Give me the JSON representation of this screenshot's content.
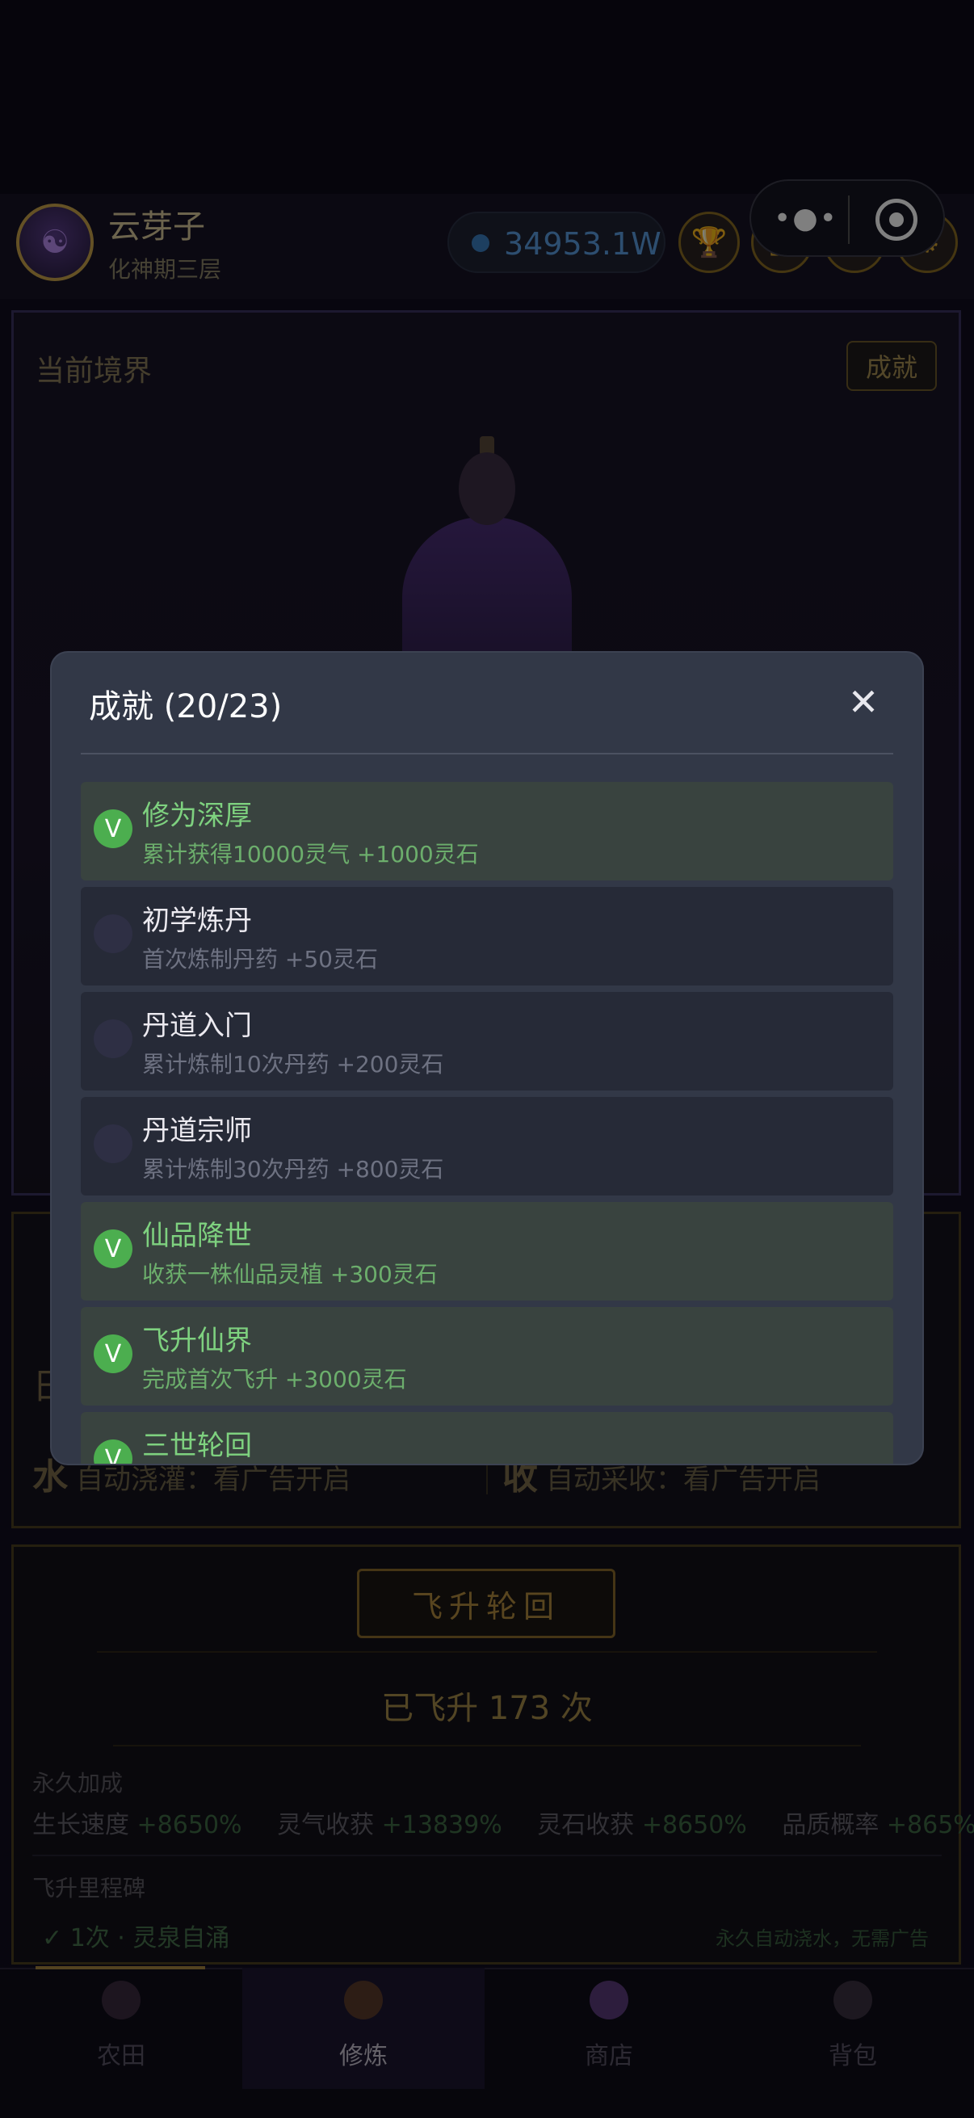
{
  "header": {
    "user_name": "云芽子",
    "user_realm": "化神期三层",
    "spirit_stones": "34953.1W",
    "avatar_glyph": "☯",
    "icons": [
      "trophy-icon",
      "book-icon",
      "help-icon",
      "settings-icon"
    ],
    "icon_glyphs": [
      "🏆",
      "▣",
      "?",
      "⚙"
    ]
  },
  "capsule": {
    "more_glyph": "•●•"
  },
  "realm": {
    "title": "当前境界",
    "achievement_button": "成就"
  },
  "farm": {
    "day_glyph": "日",
    "water_glyph": "水",
    "water_text": "自动浇灌：看广告开启",
    "harvest_glyph": "收",
    "harvest_text": "自动采收：看广告开启"
  },
  "ascension": {
    "button": "飞升轮回",
    "count_text": "已飞升 173 次",
    "permanent_label": "永久加成",
    "bonuses": [
      {
        "label": "生长速度",
        "value": "+8650%"
      },
      {
        "label": "灵气收获",
        "value": "+13839%"
      },
      {
        "label": "灵石收获",
        "value": "+8650%"
      },
      {
        "label": "品质概率",
        "value": "+865%"
      }
    ],
    "milestone_label": "飞升里程碑",
    "milestone_item": "1次 · 灵泉自涌",
    "milestone_note": "永久自动浇水，无需广告",
    "milestone_check": "✓"
  },
  "tabs": [
    {
      "label": "农田",
      "icon": "farm-icon"
    },
    {
      "label": "修炼",
      "icon": "cultivate-icon"
    },
    {
      "label": "商店",
      "icon": "shop-icon"
    },
    {
      "label": "背包",
      "icon": "bag-icon"
    }
  ],
  "modal": {
    "title": "成就 (20/23)",
    "close_glyph": "✕",
    "check_glyph": "V",
    "achievements": [
      {
        "name": "修为深厚",
        "desc": "累计获得10000灵气 +1000灵石",
        "done": true
      },
      {
        "name": "初学炼丹",
        "desc": "首次炼制丹药 +50灵石",
        "done": false
      },
      {
        "name": "丹道入门",
        "desc": "累计炼制10次丹药 +200灵石",
        "done": false
      },
      {
        "name": "丹道宗师",
        "desc": "累计炼制30次丹药 +800灵石",
        "done": false
      },
      {
        "name": "仙品降世",
        "desc": "收获一株仙品灵植 +300灵石",
        "done": true
      },
      {
        "name": "飞升仙界",
        "desc": "完成首次飞升 +3000灵石",
        "done": true
      },
      {
        "name": "三世轮回",
        "desc": "",
        "done": true
      }
    ]
  },
  "colors": {
    "accent_gold": "#c9a24a",
    "done_green": "#4cae4f",
    "modal_bg": "#323847"
  }
}
